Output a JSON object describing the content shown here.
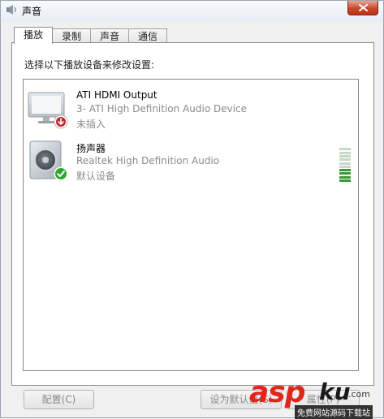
{
  "window": {
    "title": "声音"
  },
  "tabs": [
    {
      "label": "播放",
      "active": true
    },
    {
      "label": "录制",
      "active": false
    },
    {
      "label": "声音",
      "active": false
    },
    {
      "label": "通信",
      "active": false
    }
  ],
  "panel": {
    "instruction": "选择以下播放设备来修改设置:"
  },
  "devices": [
    {
      "name": "ATI HDMI Output",
      "description": "3- ATI High Definition Audio Device",
      "status": "未插入",
      "icon": "monitor-icon",
      "status_icon": "unplugged-icon"
    },
    {
      "name": "扬声器",
      "description": "Realtek High Definition Audio",
      "status": "默认设备",
      "icon": "speaker-icon",
      "status_icon": "default-check-icon",
      "level_fraction": 0.4
    }
  ],
  "buttons": {
    "configure": "配置(C)",
    "set_default": "设为默认值(S)",
    "properties": "属性(P)"
  },
  "watermark": {
    "brand_red": "asp",
    "brand_dark": "ku",
    "suffix": ".com",
    "subtitle": "免费网站源码下载站"
  },
  "colors": {
    "meter_on": "#3a9a3a",
    "meter_off": "#c8d8c8",
    "check": "#2fa52f",
    "unplugged": "#c0272d"
  }
}
